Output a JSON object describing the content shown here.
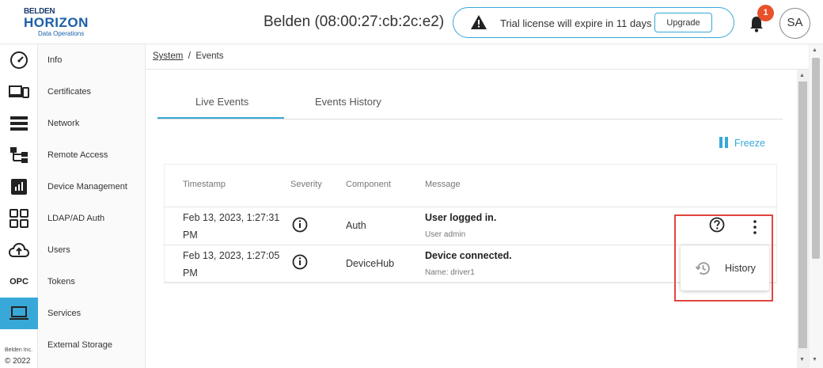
{
  "header": {
    "logo": {
      "line1": "BELDEN",
      "line2": "HORIZON",
      "line3": "Data Operations"
    },
    "device_title": "Belden (08:00:27:cb:2c:e2)",
    "license_text": "Trial license will expire in 11 days",
    "upgrade_label": "Upgrade",
    "notification_count": "1",
    "avatar_initials": "SA"
  },
  "rail": {
    "items": [
      "gauge-icon",
      "devices-icon",
      "list-icon",
      "hierarchy-icon",
      "chart-icon",
      "apps-icon",
      "cloud-upload-icon",
      "opc-icon",
      "laptop-icon"
    ],
    "opc_label": "OPC",
    "active_index": 8,
    "copyright_line1": "Belden Inc.",
    "copyright_line2": "© 2022"
  },
  "subnav": {
    "items": [
      "Info",
      "Certificates",
      "Network",
      "Remote Access",
      "Device Management",
      "LDAP/AD Auth",
      "Users",
      "Tokens",
      "Services",
      "External Storage"
    ]
  },
  "breadcrumb": {
    "parent": "System",
    "separator": "/",
    "current": "Events"
  },
  "tabs": [
    {
      "label": "Live Events",
      "active": true
    },
    {
      "label": "Events History",
      "active": false
    }
  ],
  "freeze_label": "Freeze",
  "table": {
    "columns": [
      "Timestamp",
      "Severity",
      "Component",
      "Message"
    ],
    "rows": [
      {
        "timestamp_line1": "Feb 13, 2023, 1:27:31",
        "timestamp_line2": "PM",
        "severity": "info-icon",
        "component": "Auth",
        "message_title": "User logged in.",
        "message_sub": "User admin"
      },
      {
        "timestamp_line1": "Feb 13, 2023, 1:27:05",
        "timestamp_line2": "PM",
        "severity": "info-icon",
        "component": "DeviceHub",
        "message_title": "Device connected.",
        "message_sub": "Name: driver1"
      }
    ]
  },
  "popup_menu": {
    "items": [
      {
        "label": "History",
        "icon": "history-icon"
      }
    ]
  },
  "colors": {
    "accent": "#38a8d8",
    "badge": "#e8512a",
    "highlight": "#e0453d"
  }
}
